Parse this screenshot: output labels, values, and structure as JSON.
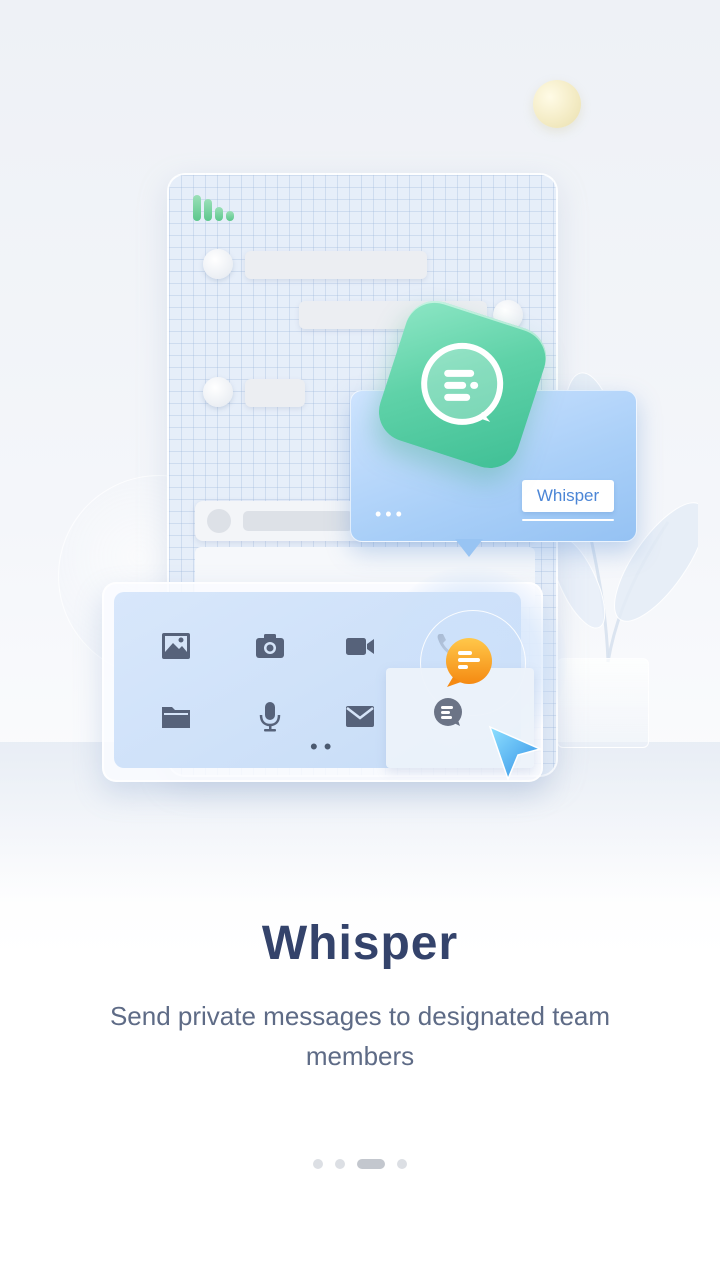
{
  "onboarding": {
    "feature_card_label": "Whisper",
    "title": "Whisper",
    "description": "Send private messages to designated team members",
    "pager": {
      "total_pages": 4,
      "active_index": 2
    }
  },
  "icons": {
    "tray_row_1": [
      "image-icon",
      "camera-icon",
      "video-icon",
      "phone-icon"
    ],
    "tray_row_2": [
      "folder-icon",
      "microphone-icon",
      "mail-icon",
      "whisper-icon"
    ]
  },
  "colors": {
    "title": "#34436b",
    "description": "#5e6b86",
    "accent_green": "#5fd2a8",
    "accent_orange": "#f7a21b",
    "accent_blue": "#4c86d6"
  }
}
